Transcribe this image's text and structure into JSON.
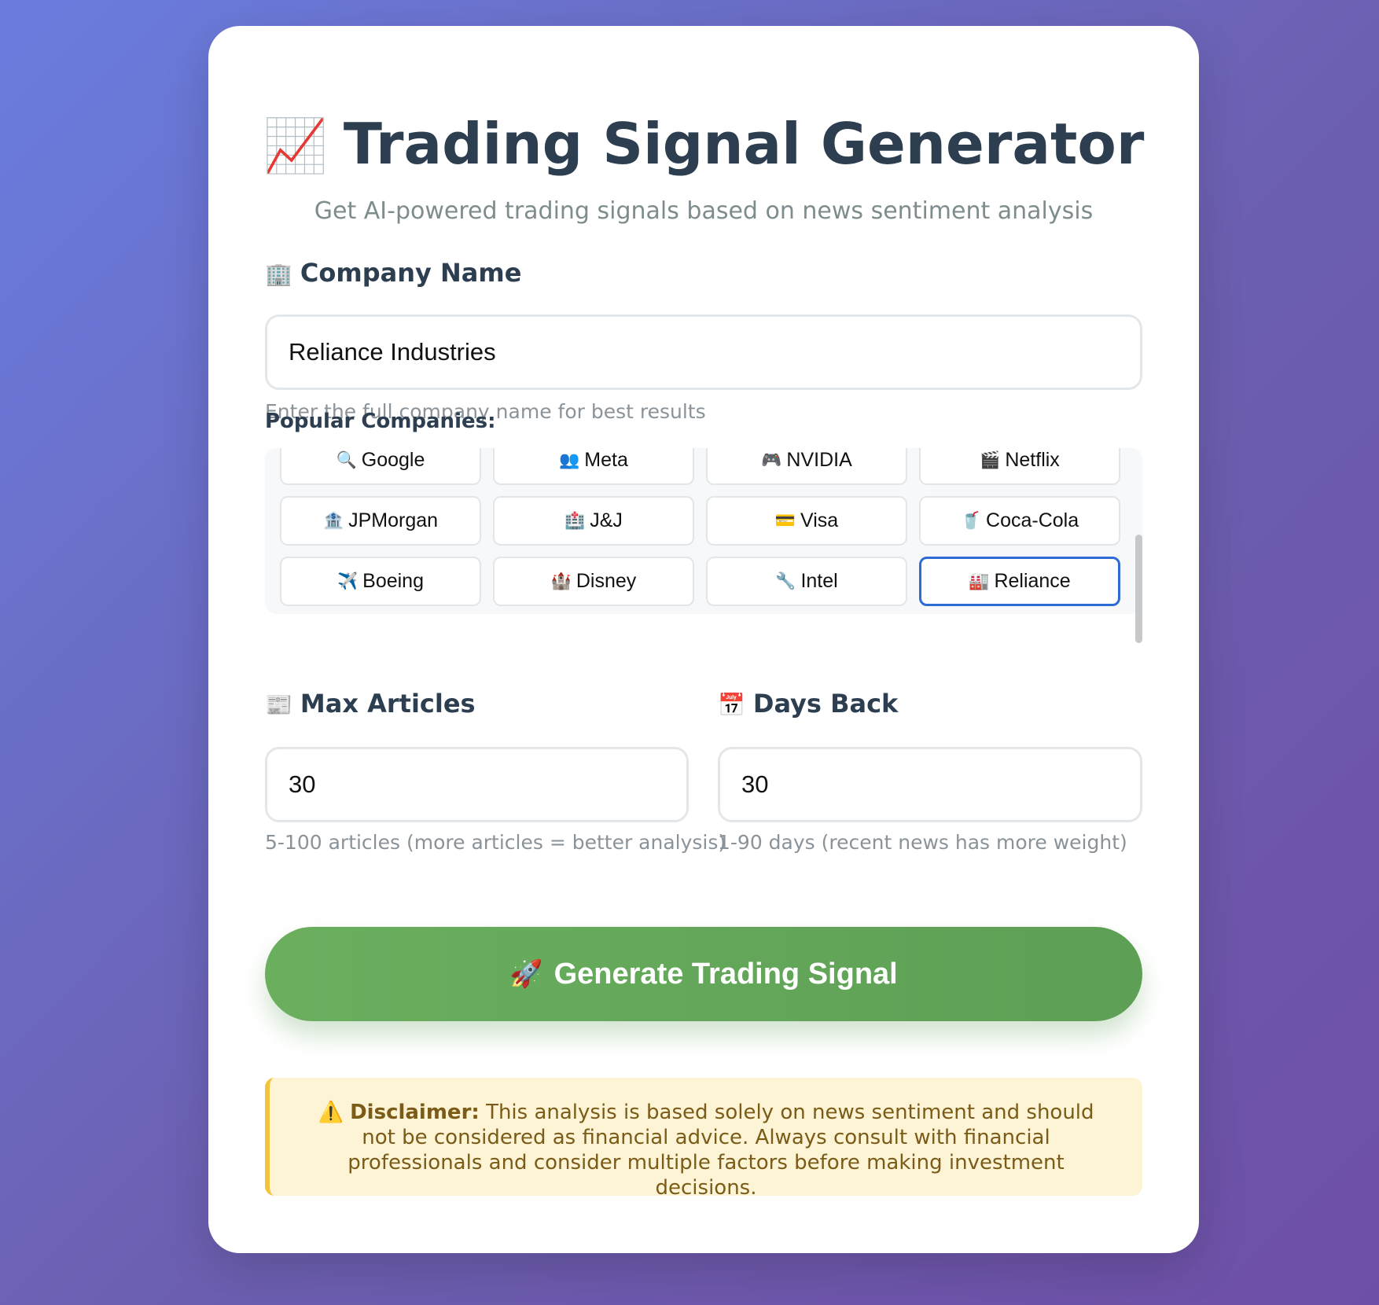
{
  "header": {
    "title_icon": "📈",
    "title": "Trading Signal Generator",
    "subtitle": "Get AI-powered trading signals based on news sentiment analysis"
  },
  "company": {
    "label_icon": "🏢",
    "label": "Company Name",
    "value": "Reliance Industries",
    "help": "Enter the full company name for best results"
  },
  "popular": {
    "label": "Popular Companies:",
    "items": [
      {
        "icon": "🔍",
        "label": "Google",
        "icon_name": "magnifier-icon"
      },
      {
        "icon": "👥",
        "label": "Meta",
        "icon_name": "people-icon"
      },
      {
        "icon": "🎮",
        "label": "NVIDIA",
        "icon_name": "gamepad-icon"
      },
      {
        "icon": "🎬",
        "label": "Netflix",
        "icon_name": "clapperboard-icon"
      },
      {
        "icon": "🏦",
        "label": "JPMorgan",
        "icon_name": "bank-icon"
      },
      {
        "icon": "🏥",
        "label": "J&J",
        "icon_name": "hospital-icon"
      },
      {
        "icon": "💳",
        "label": "Visa",
        "icon_name": "credit-card-icon"
      },
      {
        "icon": "🥤",
        "label": "Coca-Cola",
        "icon_name": "cup-icon"
      },
      {
        "icon": "✈️",
        "label": "Boeing",
        "icon_name": "airplane-icon"
      },
      {
        "icon": "🏰",
        "label": "Disney",
        "icon_name": "castle-icon"
      },
      {
        "icon": "🔧",
        "label": "Intel",
        "icon_name": "wrench-icon"
      },
      {
        "icon": "🏭",
        "label": "Reliance",
        "icon_name": "factory-icon"
      }
    ],
    "selected": "Reliance"
  },
  "max_articles": {
    "label_icon": "📰",
    "label": "Max Articles",
    "value": "30",
    "help": "5-100 articles (more articles = better analysis)"
  },
  "days_back": {
    "label_icon": "📅",
    "label": "Days Back",
    "value": "30",
    "help": "1-90 days (recent news has more weight)"
  },
  "generate": {
    "icon": "🚀",
    "label": "Generate Trading Signal"
  },
  "disclaimer": {
    "icon": "⚠️",
    "bold": "Disclaimer:",
    "text": "This analysis is based solely on news sentiment and should not be considered as financial advice. Always consult with financial professionals and consider multiple factors before making investment decisions."
  },
  "colors": {
    "accent_green": "#5d9f55",
    "selected_border": "#2f6bd4",
    "disclaimer_bg": "#fdf3d5",
    "disclaimer_border": "#f3c33e",
    "title": "#2c3e50"
  }
}
